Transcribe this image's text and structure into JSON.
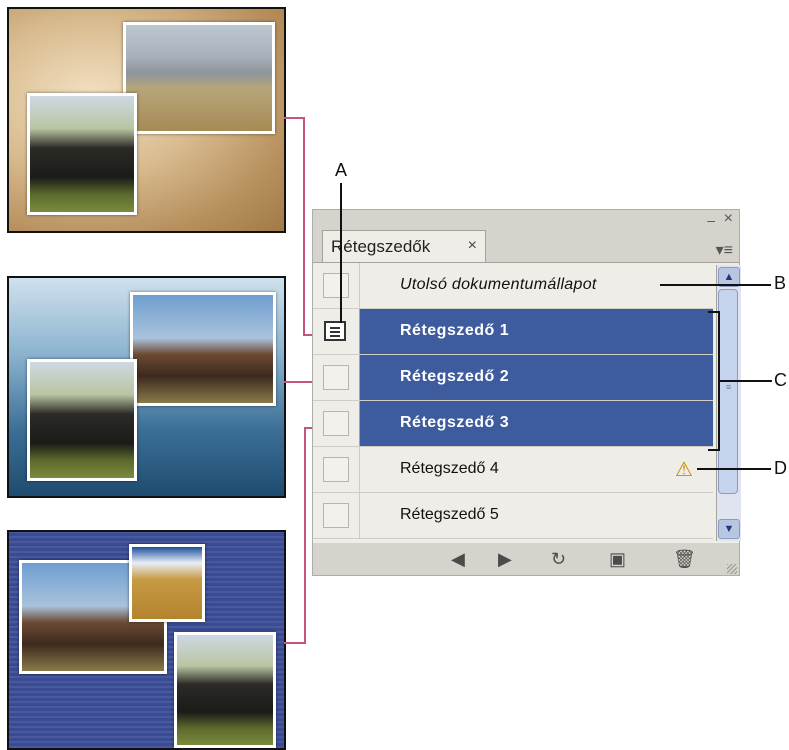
{
  "panel": {
    "tab_label": "Rétegszedők",
    "tab_close": "×",
    "minimize": "–",
    "close": "×",
    "menu": "▾≡",
    "rows": [
      {
        "label": "Utolsó dokumentumállapot",
        "selected": false
      },
      {
        "label": "Rétegszedő 1",
        "selected": true
      },
      {
        "label": "Rétegszedő 2",
        "selected": true
      },
      {
        "label": "Rétegszedő 3",
        "selected": true
      },
      {
        "label": "Rétegszedő 4",
        "selected": false
      },
      {
        "label": "Rétegszedő 5",
        "selected": false
      }
    ],
    "footer_icons": [
      "previous-icon",
      "next-icon",
      "update-icon",
      "new-layer-comp-icon",
      "delete-icon"
    ]
  },
  "callouts": {
    "a": "A",
    "b": "B",
    "c": "C",
    "d": "D"
  },
  "colors": {
    "selected": "#3e5b9e",
    "connector": "#c5557f",
    "warning": "#c48b00"
  }
}
